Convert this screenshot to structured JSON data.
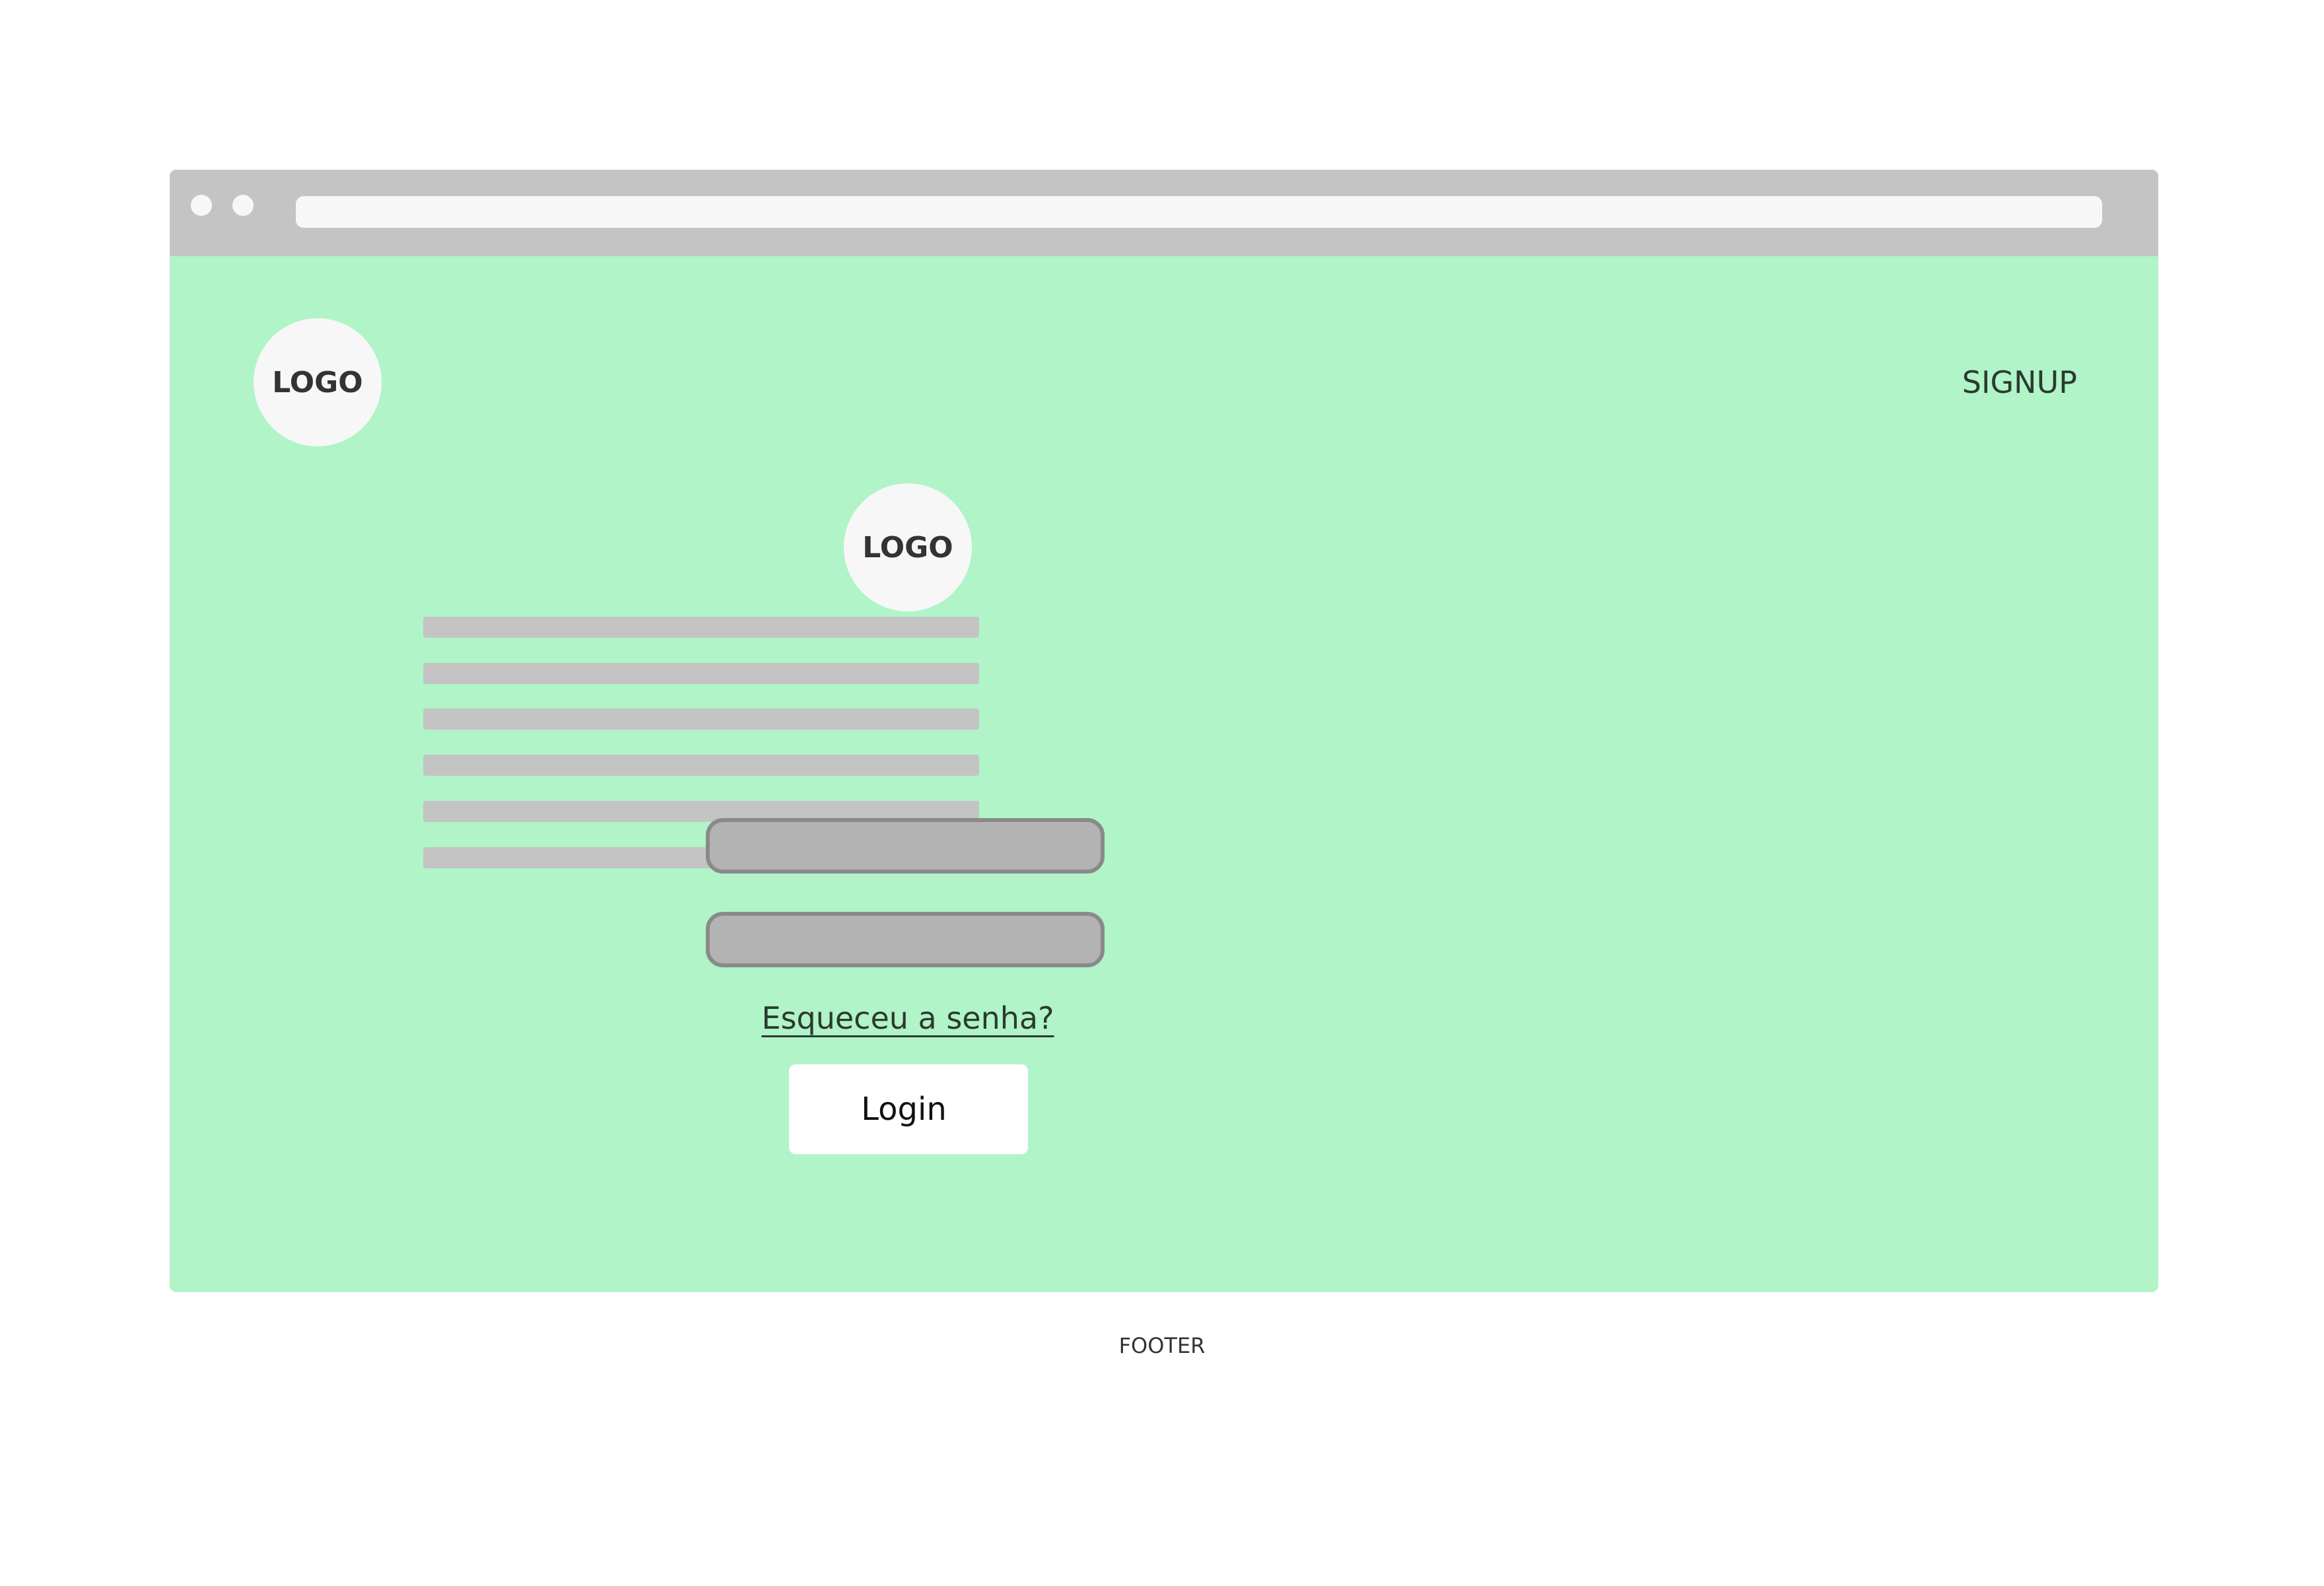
{
  "colors": {
    "content_background": "#b0f4c8",
    "browser_chrome": "#c4c4c4",
    "placeholder_line": "#c4c4c4",
    "input_fill": "#b3b3b3",
    "input_border": "#8a8a8a",
    "logo_fill": "#f7f7f7",
    "button_fill": "#ffffff"
  },
  "browser": {
    "window_dots": [
      "dot",
      "dot"
    ]
  },
  "header": {
    "logo_label": "LOGO",
    "signup_label": "SIGNUP"
  },
  "content": {
    "placeholder_text_line_count": 6
  },
  "login_form": {
    "logo_label": "LOGO",
    "username_value": "",
    "password_value": "",
    "forgot_password_label": "Esqueceu a senha?",
    "login_button_label": "Login"
  },
  "footer": {
    "label": "FOOTER"
  }
}
